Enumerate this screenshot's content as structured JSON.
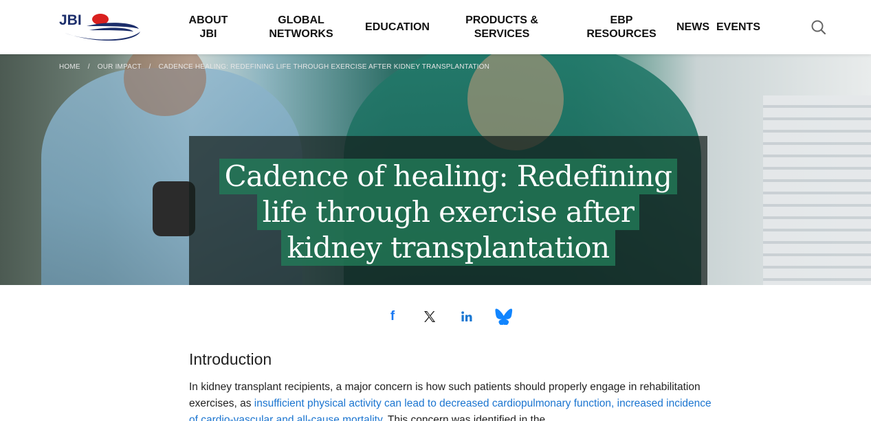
{
  "header": {
    "logo_text": "JBI",
    "nav": [
      {
        "line1": "ABOUT",
        "line2": "JBI"
      },
      {
        "line1": "GLOBAL",
        "line2": "NETWORKS"
      },
      {
        "line1": "EDUCATION",
        "line2": ""
      },
      {
        "line1": "PRODUCTS &",
        "line2": "SERVICES"
      },
      {
        "line1": "EBP",
        "line2": "RESOURCES"
      },
      {
        "line1": "NEWS",
        "line2": ""
      },
      {
        "line1": "EVENTS",
        "line2": ""
      }
    ],
    "search_icon": "search-icon"
  },
  "breadcrumb": {
    "home": "HOME",
    "section": "OUR IMPACT",
    "current": "CADENCE HEALING: REDEFINING LIFE THROUGH EXERCISE AFTER KIDNEY TRANSPLANTATION"
  },
  "hero": {
    "title_lines": [
      "Cadence of healing: Redefining",
      "life through exercise after",
      "kidney transplantation"
    ]
  },
  "share": {
    "facebook": "f",
    "icons": [
      "facebook-icon",
      "x-icon",
      "linkedin-icon",
      "bluesky-icon"
    ]
  },
  "article": {
    "heading": "Introduction",
    "p1_before": "In kidney transplant recipients, a major concern is how such patients should properly engage in rehabilitation exercises, as ",
    "p1_link": "insufficient physical activity can lead to decreased cardiopulmonary function, increased incidence of cardio-vascular and all-cause mortality",
    "p1_after": ". This concern was identified in the"
  },
  "colors": {
    "link": "#1b75d0",
    "logo_navy": "#1c2e6b",
    "logo_red": "#d9201f",
    "title_highlight": "#227a58",
    "share_blue": "#1877f2"
  }
}
